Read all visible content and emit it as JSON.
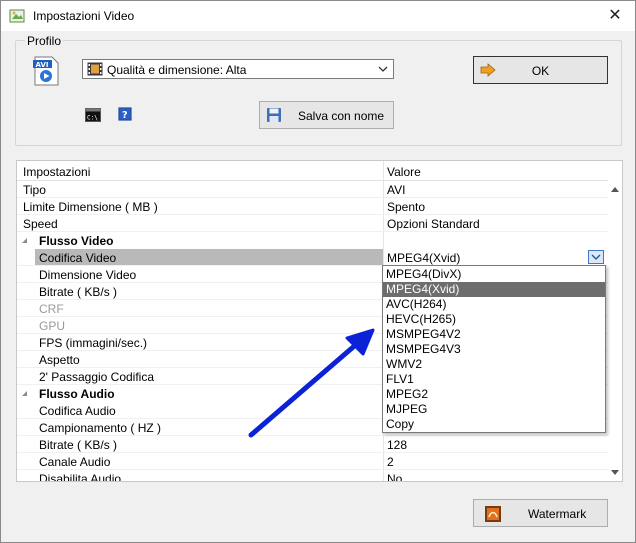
{
  "window": {
    "title": "Impostazioni Video",
    "close_glyph": "✕"
  },
  "profile": {
    "label": "Profilo",
    "selected": "Qualità e dimensione: Alta",
    "ok_label": "OK",
    "save_label": "Salva con nome"
  },
  "grid": {
    "header_key": "Impostazioni",
    "header_value": "Valore",
    "rows": [
      {
        "key": "Tipo",
        "value": "AVI"
      },
      {
        "key": "Limite Dimensione ( MB )",
        "value": "Spento"
      },
      {
        "key": "Speed",
        "value": "Opzioni Standard"
      },
      {
        "key": "Flusso Video",
        "value": ""
      },
      {
        "key": "Codifica Video",
        "value": "MPEG4(Xvid)"
      },
      {
        "key": "Dimensione Video",
        "value": ""
      },
      {
        "key": "Bitrate ( KB/s )",
        "value": ""
      },
      {
        "key": "CRF",
        "value": ""
      },
      {
        "key": "GPU",
        "value": ""
      },
      {
        "key": "FPS (immagini/sec.)",
        "value": ""
      },
      {
        "key": "Aspetto",
        "value": ""
      },
      {
        "key": "2' Passaggio Codifica",
        "value": ""
      },
      {
        "key": "Flusso Audio",
        "value": ""
      },
      {
        "key": "Codifica Audio",
        "value": ""
      },
      {
        "key": "Campionamento ( HZ )",
        "value": ""
      },
      {
        "key": "Bitrate ( KB/s )",
        "value": "128"
      },
      {
        "key": "Canale Audio",
        "value": "2"
      },
      {
        "key": "Disabilita Audio",
        "value": "No"
      }
    ]
  },
  "codec_dropdown": {
    "options": [
      "MPEG4(DivX)",
      "MPEG4(Xvid)",
      "AVC(H264)",
      "HEVC(H265)",
      "MSMPEG4V2",
      "MSMPEG4V3",
      "WMV2",
      "FLV1",
      "MPEG2",
      "MJPEG",
      "Copy"
    ],
    "selected": "MPEG4(Xvid)"
  },
  "watermark": {
    "label": "Watermark"
  },
  "colors": {
    "accent": "#0b22d6",
    "selection": "#6d6d6d"
  }
}
